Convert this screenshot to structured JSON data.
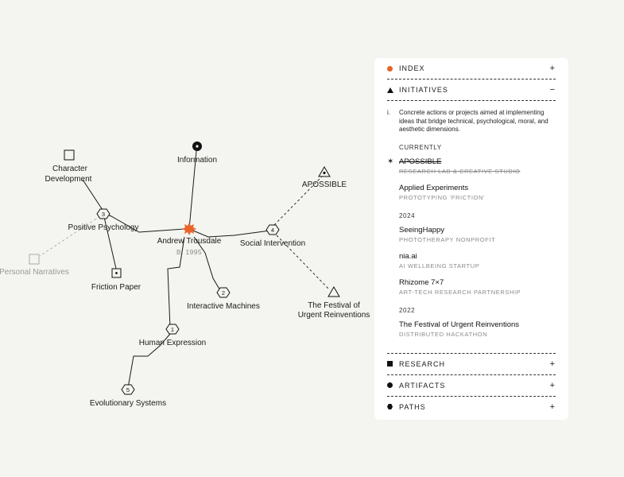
{
  "graph": {
    "center": {
      "label": "Andrew Trousdale",
      "sub": "B. 1995"
    },
    "nodes": {
      "information": "Information",
      "apossible": "APOSSIBLE",
      "social": "Social Intervention",
      "social_num": "4",
      "festival_l1": "The Festival of",
      "festival_l2": "Urgent Reinventions",
      "interactive": "Interactive Machines",
      "interactive_num": "2",
      "human": "Human Expression",
      "human_num": "1",
      "evolutionary": "Evolutionary Systems",
      "evolutionary_num": "5",
      "positive": "Positive Psychology",
      "positive_num": "3",
      "character_l1": "Character",
      "character_l2": "Development",
      "friction": "Friction Paper",
      "personal": "Personal Narratives"
    },
    "colors": {
      "accent": "#e8642c",
      "line": "#1a1a1a",
      "muted": "#aaaaaa"
    }
  },
  "panel": {
    "sections": {
      "index": {
        "label": "INDEX",
        "toggle": "+",
        "icon": "orange-dot-icon"
      },
      "initiatives": {
        "label": "INITIATIVES",
        "toggle": "−",
        "icon": "triangle-icon"
      },
      "research": {
        "label": "RESEARCH",
        "toggle": "+",
        "icon": "square-icon"
      },
      "artifacts": {
        "label": "ARTIFACTS",
        "toggle": "+",
        "icon": "circle-icon"
      },
      "paths": {
        "label": "PATHS",
        "toggle": "+",
        "icon": "hexagon-icon"
      }
    },
    "initiatives_body": {
      "roman": "i.",
      "description": "Concrete actions or projects aimed at implementing ideas that bridge technical, psychological, moral, and aesthetic dimensions.",
      "groups": [
        {
          "title": "CURRENTLY",
          "items": [
            {
              "title": "APOSSIBLE",
              "sub": "RESEARCH LAB & CREATIVE STUDIO",
              "star": "✶"
            },
            {
              "title": "Applied Experiments",
              "sub": "PROTOTYPING 'FRICTION'"
            }
          ]
        },
        {
          "title": "2024",
          "items": [
            {
              "title": "SeeingHappy",
              "sub": "PHOTOTHERAPY NONPROFIT"
            },
            {
              "title": "nia.ai",
              "sub": "AI WELLBEING STARTUP"
            },
            {
              "title": "Rhizome 7×7",
              "sub": "ART-TECH RESEARCH PARTNERSHIP"
            }
          ]
        },
        {
          "title": "2022",
          "items": [
            {
              "title": "The Festival of Urgent Reinventions",
              "sub": "DISTRIBUTED HACKATHON"
            }
          ]
        }
      ]
    }
  }
}
